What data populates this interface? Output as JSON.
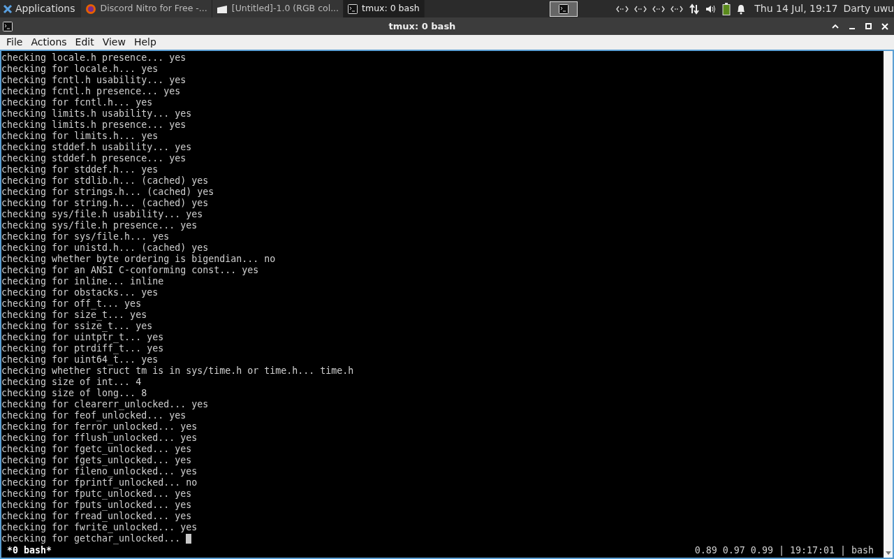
{
  "panel": {
    "menu": "Applications",
    "tasks": [
      {
        "title": "Discord Nitro for Free -...",
        "kind": "browser",
        "selected": false
      },
      {
        "title": "[Untitled]-1.0 (RGB col...",
        "kind": "image",
        "selected": false
      },
      {
        "title": "tmux: 0 bash",
        "kind": "terminal",
        "selected": true
      }
    ],
    "clock": "Thu 14 Jul, 19:17",
    "user": "Darty uwu"
  },
  "window": {
    "title": "tmux: 0 bash"
  },
  "menu": [
    "File",
    "Actions",
    "Edit",
    "View",
    "Help"
  ],
  "terminal": {
    "lines": [
      "checking locale.h presence... yes",
      "checking for locale.h... yes",
      "checking fcntl.h usability... yes",
      "checking fcntl.h presence... yes",
      "checking for fcntl.h... yes",
      "checking limits.h usability... yes",
      "checking limits.h presence... yes",
      "checking for limits.h... yes",
      "checking stddef.h usability... yes",
      "checking stddef.h presence... yes",
      "checking for stddef.h... yes",
      "checking for stdlib.h... (cached) yes",
      "checking for strings.h... (cached) yes",
      "checking for string.h... (cached) yes",
      "checking sys/file.h usability... yes",
      "checking sys/file.h presence... yes",
      "checking for sys/file.h... yes",
      "checking for unistd.h... (cached) yes",
      "checking whether byte ordering is bigendian... no",
      "checking for an ANSI C-conforming const... yes",
      "checking for inline... inline",
      "checking for obstacks... yes",
      "checking for off_t... yes",
      "checking for size_t... yes",
      "checking for ssize_t... yes",
      "checking for uintptr_t... yes",
      "checking for ptrdiff_t... yes",
      "checking for uint64_t... yes",
      "checking whether struct tm is in sys/time.h or time.h... time.h",
      "checking size of int... 4",
      "checking size of long... 8",
      "checking for clearerr_unlocked... yes",
      "checking for feof_unlocked... yes",
      "checking for ferror_unlocked... yes",
      "checking for fflush_unlocked... yes",
      "checking for fgetc_unlocked... yes",
      "checking for fgets_unlocked... yes",
      "checking for fileno_unlocked... yes",
      "checking for fprintf_unlocked... no",
      "checking for fputc_unlocked... yes",
      "checking for fputs_unlocked... yes",
      "checking for fread_unlocked... yes",
      "checking for fwrite_unlocked... yes",
      "checking for getchar_unlocked... "
    ],
    "status_left": "*0 bash*",
    "status_right": "0.89 0.97 0.99 | 19:17:01 | bash"
  }
}
